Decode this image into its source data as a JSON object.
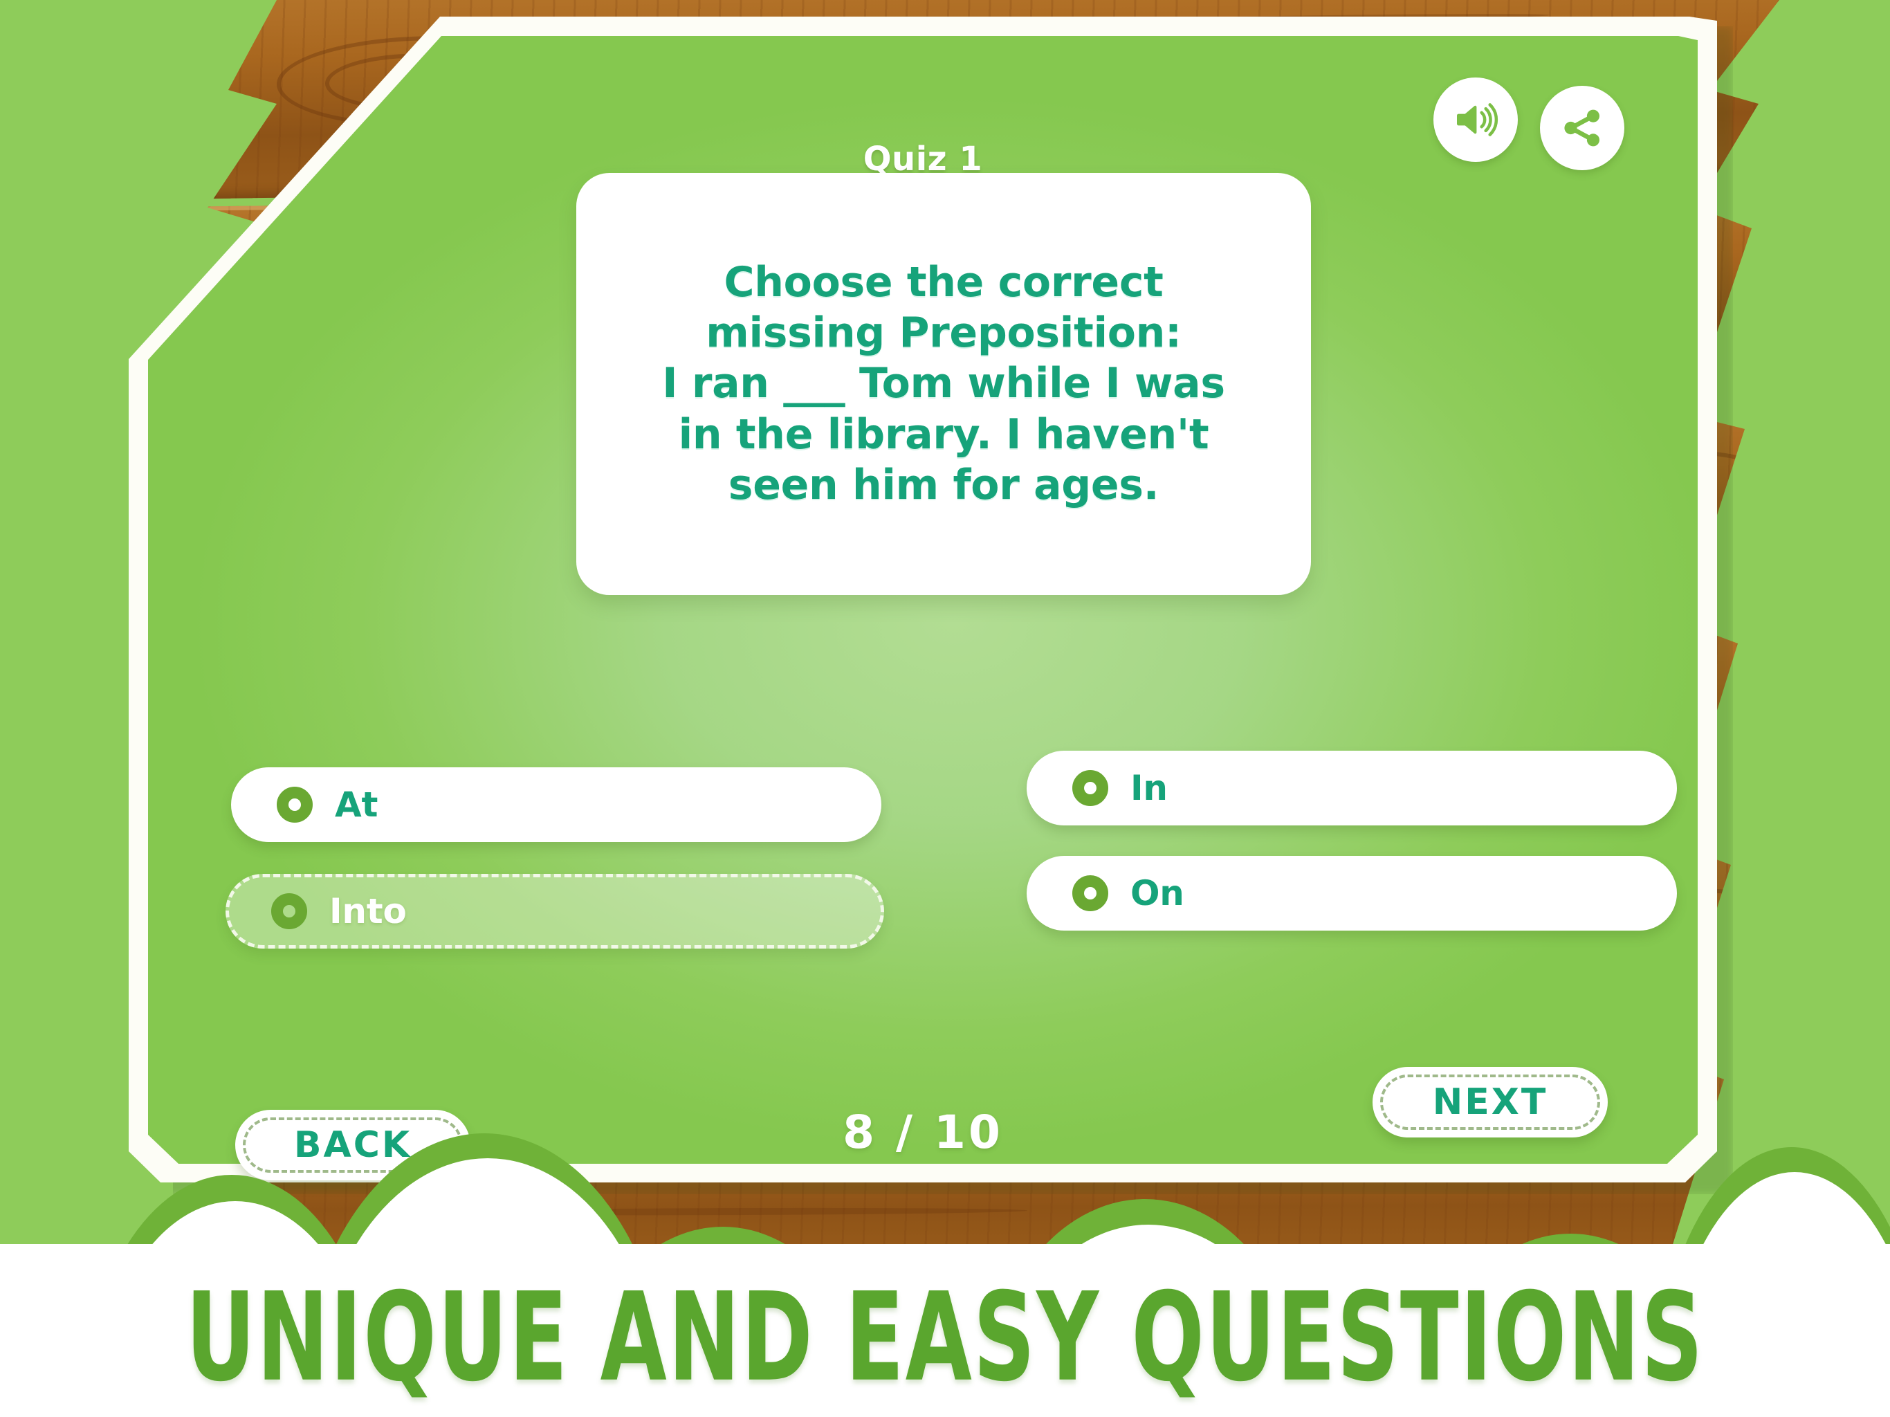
{
  "header": {
    "title": "Quiz 1",
    "sound_icon": "sound-on-icon",
    "share_icon": "share-icon"
  },
  "question": {
    "text": "Choose the correct missing Preposition:\nI ran ___ Tom while I was in the library. I haven't seen him for ages."
  },
  "options": [
    {
      "label": "At",
      "selected": false
    },
    {
      "label": "In",
      "selected": false
    },
    {
      "label": "Into",
      "selected": true
    },
    {
      "label": "On",
      "selected": false
    }
  ],
  "footer": {
    "back_label": "BACK",
    "next_label": "NEXT",
    "progress": "8 / 10",
    "current": 8,
    "total": 10
  },
  "banner": {
    "text": "UNIQUE AND EASY QUESTIONS"
  },
  "colors": {
    "panel_green": "#8ecc5a",
    "panel_green_light": "#b2dd93",
    "teal_text": "#16a37a",
    "radio_green": "#6aa832",
    "banner_green": "#5aa62e",
    "wood_brown": "#a9671f",
    "white": "#ffffff"
  }
}
